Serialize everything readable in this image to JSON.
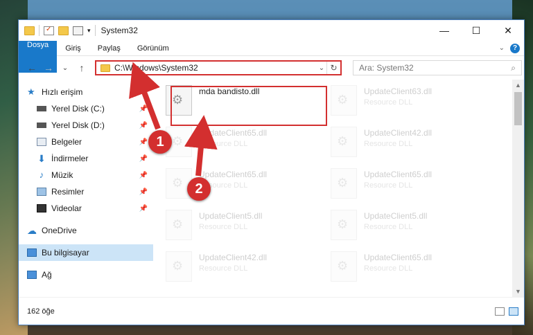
{
  "window": {
    "title": "System32",
    "controls": {
      "minimize": "—",
      "maximize": "☐",
      "close": "✕"
    }
  },
  "ribbon": {
    "tabs": [
      "Dosya",
      "Giriş",
      "Paylaş",
      "Görünüm"
    ],
    "help": "?",
    "collapse": "⌄"
  },
  "nav": {
    "back": "←",
    "forward": "→",
    "recent": "⌄",
    "up": "↑",
    "path": "C:\\Windows\\System32",
    "dropdown": "⌄",
    "refresh": "↻",
    "search_placeholder": "Ara: System32",
    "search_icon": "⌕"
  },
  "sidebar": {
    "quick_access": "Hızlı erişim",
    "items": [
      {
        "label": "Yerel Disk (C:)",
        "icon": "drive-icon",
        "pinned": true
      },
      {
        "label": "Yerel Disk (D:)",
        "icon": "drive-icon",
        "pinned": true
      },
      {
        "label": "Belgeler",
        "icon": "documents-icon",
        "pinned": true
      },
      {
        "label": "İndirmeler",
        "icon": "downloads-icon",
        "pinned": true
      },
      {
        "label": "Müzik",
        "icon": "music-icon",
        "pinned": true
      },
      {
        "label": "Resimler",
        "icon": "pictures-icon",
        "pinned": true
      },
      {
        "label": "Videolar",
        "icon": "videos-icon",
        "pinned": true
      }
    ],
    "onedrive": "OneDrive",
    "this_pc": "Bu bilgisayar",
    "network": "Ağ"
  },
  "files": [
    {
      "name": "mda bandisto.dll",
      "type": "",
      "highlighted": true
    },
    {
      "name": "UpdateClient63.dll",
      "type": "Resource DLL"
    },
    {
      "name": "UpdateClient65.dll",
      "type": "Resource DLL"
    },
    {
      "name": "UpdateClient42.dll",
      "type": "Resource DLL"
    },
    {
      "name": "UpdateClient65.dll",
      "type": "Resource DLL"
    },
    {
      "name": "UpdateClient65.dll",
      "type": "Resource DLL"
    },
    {
      "name": "UpdateClient5.dll",
      "type": "Resource DLL"
    },
    {
      "name": "UpdateClient5.dll",
      "type": "Resource DLL"
    },
    {
      "name": "UpdateClient42.dll",
      "type": "Resource DLL"
    },
    {
      "name": "UpdateClient65.dll",
      "type": "Resource DLL"
    }
  ],
  "status": {
    "count": "162 öğe"
  },
  "markers": [
    "1",
    "2"
  ],
  "colors": {
    "accent": "#1979ca",
    "highlight": "#d32f2f",
    "selected": "#cce4f7"
  }
}
